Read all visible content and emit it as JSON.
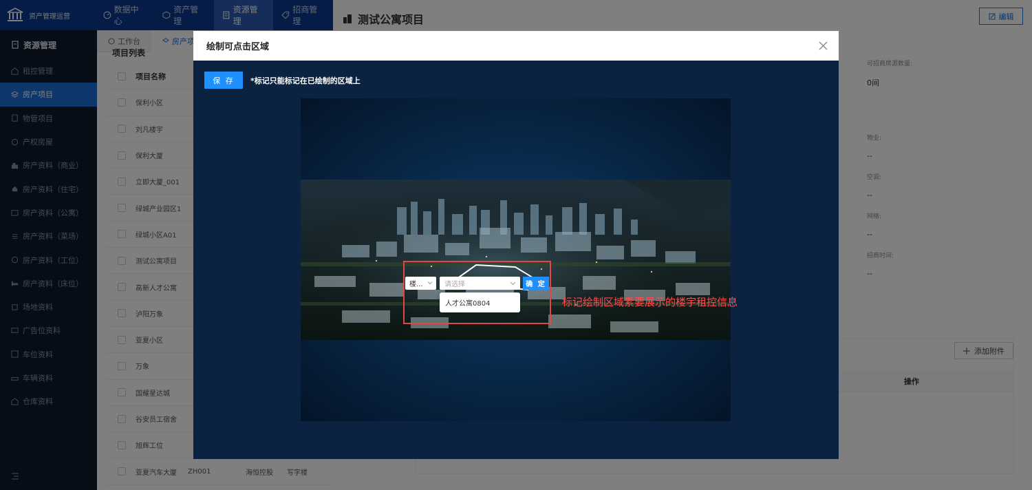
{
  "app": {
    "title": "资产管理运营"
  },
  "topnav": {
    "items": [
      {
        "label": "数据中心",
        "icon": "dashboard-icon"
      },
      {
        "label": "资产管理",
        "icon": "cube-icon"
      },
      {
        "label": "资源管理",
        "icon": "document-icon",
        "active": true
      },
      {
        "label": "招商管理",
        "icon": "tag-icon"
      }
    ]
  },
  "sidebar": {
    "header": "资源管理",
    "items": [
      {
        "label": "租控管理"
      },
      {
        "label": "房产项目",
        "active": true
      },
      {
        "label": "物管项目"
      },
      {
        "label": "产权房屋"
      },
      {
        "label": "房产资料（商业）"
      },
      {
        "label": "房产资料（住宅）"
      },
      {
        "label": "房产资料（公寓）"
      },
      {
        "label": "房产资料（菜场）"
      },
      {
        "label": "房产资料（工位）"
      },
      {
        "label": "房产资料（床位）"
      },
      {
        "label": "场地资料"
      },
      {
        "label": "广告位资料"
      },
      {
        "label": "车位资料"
      },
      {
        "label": "车辆资料"
      },
      {
        "label": "仓库资料"
      }
    ]
  },
  "tabs": [
    {
      "label": "工作台"
    },
    {
      "label": "房产项",
      "active": true
    }
  ],
  "list": {
    "title": "项目列表",
    "header": "项目名称",
    "rows": [
      {
        "name": "保利小区",
        "code": "",
        "company": "",
        "type": ""
      },
      {
        "name": "刘凡楼宇",
        "code": "",
        "company": "",
        "type": ""
      },
      {
        "name": "保利大厦",
        "code": "",
        "company": "",
        "type": ""
      },
      {
        "name": "立即大厦_001",
        "code": "",
        "company": "",
        "type": ""
      },
      {
        "name": "绿城产业园区1",
        "code": "",
        "company": "",
        "type": ""
      },
      {
        "name": "绿城小区A01",
        "code": "",
        "company": "",
        "type": ""
      },
      {
        "name": "测试公寓项目",
        "code": "",
        "company": "",
        "type": ""
      },
      {
        "name": "高新人才公寓",
        "code": "",
        "company": "",
        "type": ""
      },
      {
        "name": "泸阳万象",
        "code": "",
        "company": "",
        "type": ""
      },
      {
        "name": "亚夏小区",
        "code": "",
        "company": "",
        "type": ""
      },
      {
        "name": "万象",
        "code": "",
        "company": "",
        "type": ""
      },
      {
        "name": "国耀星达城",
        "code": "",
        "company": "",
        "type": ""
      },
      {
        "name": "谷安员工宿舍",
        "code": "",
        "company": "",
        "type": ""
      },
      {
        "name": "旭辉工位",
        "code": "",
        "company": "",
        "type": ""
      },
      {
        "name": "亚夏汽车大厦",
        "code": "ZH001",
        "company": "海恒控股",
        "type": "写字楼"
      }
    ]
  },
  "detail": {
    "title": "测试公寓项目",
    "edit_label": "编辑",
    "fields": [
      {
        "label": "可招商房源数量:",
        "value": "0间"
      },
      {
        "label": "物业:",
        "value": "--"
      },
      {
        "label": "空调:",
        "value": "--"
      },
      {
        "label": "网络:",
        "value": "--"
      },
      {
        "label": "招商时间:",
        "value": "--"
      }
    ],
    "add_attachment_label": "添加附件",
    "operation_header": "操作"
  },
  "modal": {
    "title": "绘制可点击区域",
    "save_label": "保 存",
    "note": "*标记只能标记在已绘制的区域上",
    "building_select": "楼...",
    "room_select_placeholder": "请选择",
    "confirm_label": "确 定",
    "dropdown_option": "人才公寓0804",
    "annotation": "标记绘制区域素要展示的楼宇租控信息"
  },
  "colors": {
    "topbar": "#0b3b8c",
    "sidebar": "#0f1a2e",
    "accent": "#1c6fd6",
    "modal_bg": "#0b2340",
    "annotation": "#ff4d4f"
  }
}
